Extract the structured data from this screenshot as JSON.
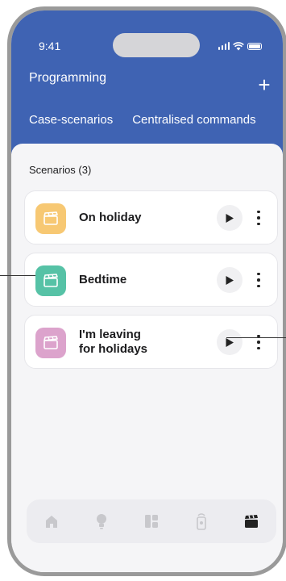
{
  "status_bar": {
    "time": "9:41"
  },
  "header": {
    "title": "Programming",
    "add_label": "+",
    "tabs": [
      {
        "label": "Case-scenarios"
      },
      {
        "label": "Centralised commands"
      }
    ]
  },
  "scenarios": {
    "section_title": "Scenarios (3)",
    "items": [
      {
        "label_line1": "On holiday",
        "label_line2": "",
        "icon_color": "#f7c873"
      },
      {
        "label_line1": "Bedtime",
        "label_line2": "",
        "icon_color": "#56c2a6"
      },
      {
        "label_line1": "I'm leaving",
        "label_line2": "for holidays",
        "icon_color": "#dca3cc"
      }
    ]
  },
  "bottom_nav": {
    "items": [
      {
        "icon": "home-icon",
        "active": false
      },
      {
        "icon": "lightbulb-icon",
        "active": false
      },
      {
        "icon": "dashboard-icon",
        "active": false
      },
      {
        "icon": "remote-icon",
        "active": false
      },
      {
        "icon": "clapperboard-icon",
        "active": true
      }
    ]
  },
  "colors": {
    "header_blue": "#3f63b3",
    "background": "#f5f5f7",
    "nav_active": "#222222",
    "nav_inactive": "#c8c8cc"
  }
}
